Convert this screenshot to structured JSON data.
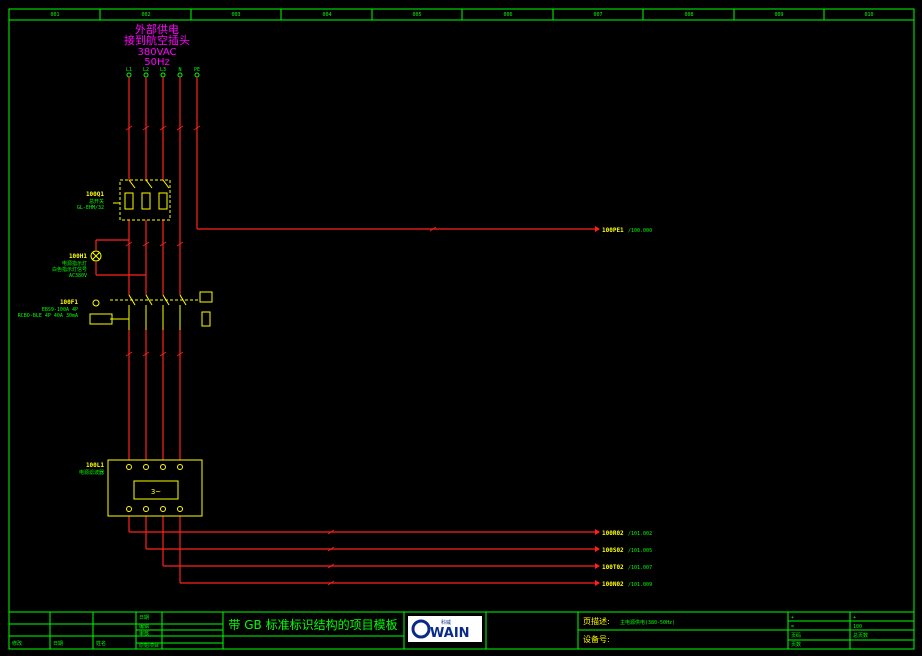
{
  "columns": [
    "001",
    "002",
    "003",
    "004",
    "005",
    "006",
    "007",
    "008",
    "009",
    "010"
  ],
  "supply": {
    "line1": "外部供电",
    "line2": "接到航空插头",
    "line3": "380VAC",
    "line4": "50Hz",
    "terminals": [
      "L1",
      "L2",
      "L3",
      "N",
      "PE"
    ]
  },
  "devices": {
    "q1": {
      "tag": "100Q1",
      "desc1": "总开关",
      "desc2": "GL-EHM/32"
    },
    "h1": {
      "tag": "100H1",
      "desc1": "电源指示灯",
      "desc2": "白色指示灯信号",
      "desc3": "AC380V"
    },
    "f1": {
      "tag": "100F1",
      "desc1": "EBS9-100A 4P",
      "desc2": "RCBO-BLE 4P 40A 30mA"
    },
    "l1": {
      "tag": "100L1",
      "desc1": "电源滤波器",
      "inner": "3~"
    }
  },
  "outputs": [
    {
      "tag": "100PE1",
      "ref": "/100.000"
    },
    {
      "tag": "100R02",
      "ref": "/101.002"
    },
    {
      "tag": "100S02",
      "ref": "/101.005"
    },
    {
      "tag": "100T02",
      "ref": "/101.007"
    },
    {
      "tag": "100N02",
      "ref": "/101.009"
    }
  ],
  "title_block": {
    "revision_labels": [
      "修改",
      "日期",
      "姓名"
    ],
    "date_label": "日期",
    "edit_label": "编辑",
    "check_label": "审核",
    "standard_label": "原始项目",
    "project_title": "带 GB 标准标识结构的项目模板",
    "logo_text": "WAIN",
    "logo_small": "科威",
    "page_desc_label": "页描述:",
    "page_desc_value": "主电源供电(380-50Hz)",
    "device_label": "设备号:",
    "right_col1": [
      "+",
      "=",
      "页码",
      "页数"
    ],
    "right_col2": [
      "+",
      "100",
      "总页数"
    ]
  },
  "colors": {
    "border": "#00ff00",
    "wire": "#ff2020",
    "symbol": "#ffff00",
    "heading": "#ff00ff",
    "text": "#00ff00",
    "background": "#000000"
  }
}
